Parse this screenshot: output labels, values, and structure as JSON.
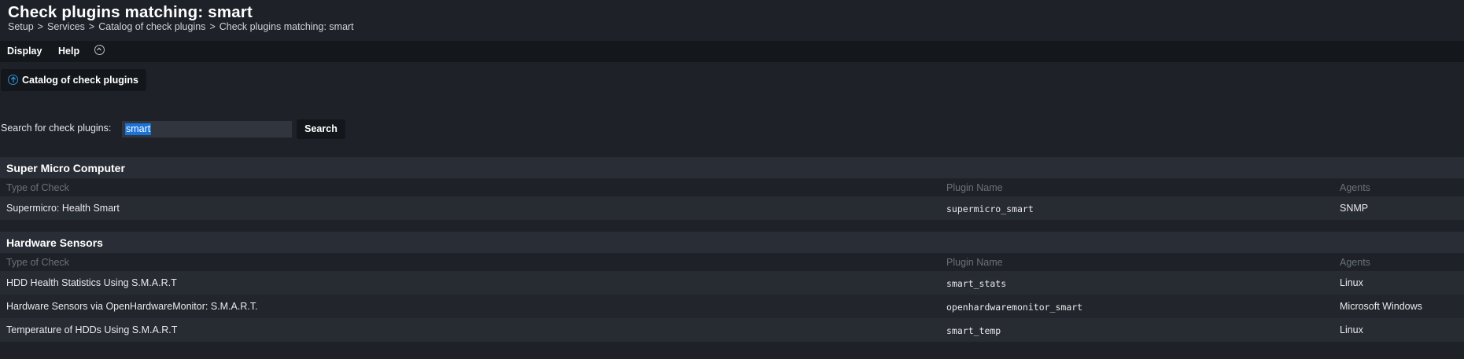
{
  "header": {
    "title": "Check plugins matching: smart",
    "breadcrumb": [
      "Setup",
      "Services",
      "Catalog of check plugins",
      "Check plugins matching: smart"
    ],
    "separator": ">"
  },
  "menubar": {
    "items": [
      "Display",
      "Help"
    ],
    "toggle_icon": "chevron-up-circle-icon"
  },
  "catalog_button": {
    "label": "Catalog of check plugins",
    "icon": "up-arrow-circle-icon"
  },
  "search": {
    "label": "Search for check plugins:",
    "value": "smart",
    "button_label": "Search"
  },
  "columns": {
    "type": "Type of Check",
    "plugin": "Plugin Name",
    "agents": "Agents"
  },
  "groups": [
    {
      "title": "Super Micro Computer",
      "rows": [
        {
          "type": "Supermicro: Health Smart",
          "plugin": "supermicro_smart",
          "agents": "SNMP"
        }
      ]
    },
    {
      "title": "Hardware Sensors",
      "rows": [
        {
          "type": "HDD Health Statistics Using S.M.A.R.T",
          "plugin": "smart_stats",
          "agents": "Linux"
        },
        {
          "type": "Hardware Sensors via OpenHardwareMonitor: S.M.A.R.T.",
          "plugin": "openhardwaremonitor_smart",
          "agents": "Microsoft Windows"
        },
        {
          "type": "Temperature of HDDs Using S.M.A.R.T",
          "plugin": "smart_temp",
          "agents": "Linux"
        }
      ]
    }
  ],
  "colors": {
    "background": "#1e2228",
    "menubar": "#14171b",
    "selection": "#1a73d9",
    "accent_icon": "#2d8fd5"
  }
}
